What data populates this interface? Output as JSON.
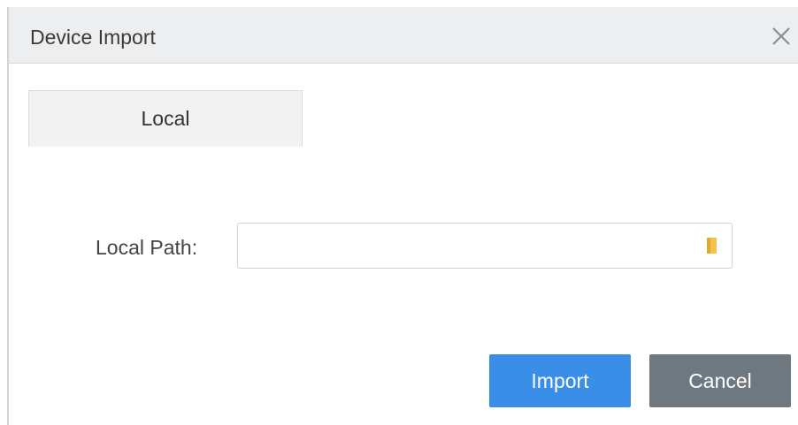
{
  "dialog": {
    "title": "Device Import",
    "close_icon": "close-icon"
  },
  "tabs": [
    {
      "label": "Local",
      "active": true
    }
  ],
  "form": {
    "local_path_label": "Local Path:",
    "local_path_value": "",
    "local_path_placeholder": "",
    "browse_icon": "folder-icon"
  },
  "buttons": {
    "import_label": "Import",
    "cancel_label": "Cancel"
  },
  "colors": {
    "primary": "#3b8ee8",
    "secondary": "#6e7880",
    "folder": "#f2c14e"
  }
}
